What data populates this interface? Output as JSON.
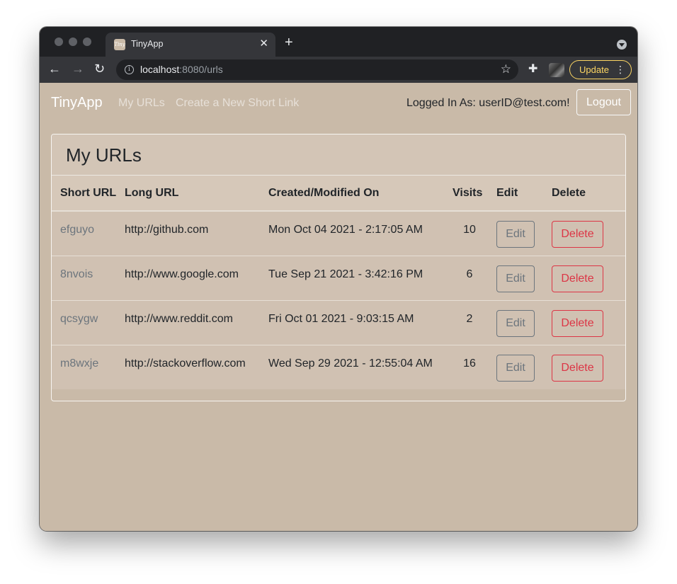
{
  "browser": {
    "tab_title": "TinyApp",
    "tab_favicon_text": "Tiny",
    "url_host": "localhost",
    "url_path": ":8080/urls",
    "update_label": "Update"
  },
  "navbar": {
    "brand": "TinyApp",
    "links": [
      "My URLs",
      "Create a New Short Link"
    ],
    "logged_in_text": "Logged In As: userID@test.com!",
    "logout_label": "Logout"
  },
  "card": {
    "title": "My URLs",
    "columns": [
      "Short URL",
      "Long URL",
      "Created/Modified On",
      "Visits",
      "Edit",
      "Delete"
    ],
    "rows": [
      {
        "short": "efguyo",
        "long": "http://github.com",
        "date": "Mon Oct 04 2021 - 2:17:05 AM",
        "visits": "10",
        "edit": "Edit",
        "delete": "Delete"
      },
      {
        "short": "8nvois",
        "long": "http://www.google.com",
        "date": "Tue Sep 21 2021 - 3:42:16 PM",
        "visits": "6",
        "edit": "Edit",
        "delete": "Delete"
      },
      {
        "short": "qcsygw",
        "long": "http://www.reddit.com",
        "date": "Fri Oct 01 2021 - 9:03:15 AM",
        "visits": "2",
        "edit": "Edit",
        "delete": "Delete"
      },
      {
        "short": "m8wxje",
        "long": "http://stackoverflow.com",
        "date": "Wed Sep 29 2021 - 12:55:04 AM",
        "visits": "16",
        "edit": "Edit",
        "delete": "Delete"
      }
    ]
  },
  "colors": {
    "page_background": "#c9baa8",
    "danger": "#dc3545",
    "secondary": "#6c757d",
    "update_accent": "#fdd663"
  }
}
